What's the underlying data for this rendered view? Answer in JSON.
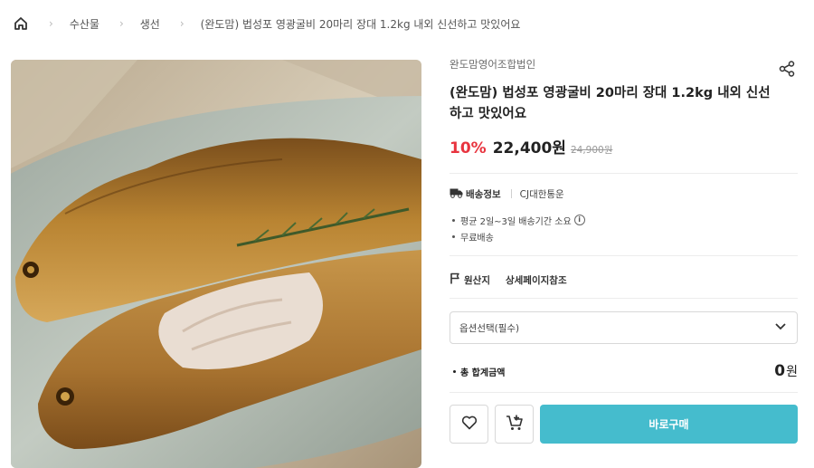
{
  "breadcrumb": {
    "home_icon": "home-icon",
    "items": [
      "수산물",
      "생선",
      "(완도맘) 법성포 영광굴비 20마리 장대 1.2kg 내외 신선하고 맛있어요"
    ]
  },
  "product_image": {
    "description_icon": "product-photo"
  },
  "seller": "완도맘영어조합법인",
  "title": "(완도맘) 법성포 영광굴비 20마리 장대 1.2kg 내외 신선하고 맛있어요",
  "price": {
    "discount": "10%",
    "sale": "22,400원",
    "original": "24,900원"
  },
  "shipping": {
    "label": "배송정보",
    "carrier": "CJ대한통운",
    "notes": [
      "평균 2일~3일 배송기간 소요",
      "무료배송"
    ]
  },
  "origin": {
    "label": "원산지",
    "value": "상세페이지참조"
  },
  "option_select": {
    "placeholder": "옵션선택(필수)"
  },
  "total": {
    "label": "총 합계금액",
    "amount": "0",
    "unit": "원"
  },
  "actions": {
    "buy_label": "바로구매"
  },
  "colors": {
    "accent": "#45bccd",
    "discount": "#e8343f"
  }
}
